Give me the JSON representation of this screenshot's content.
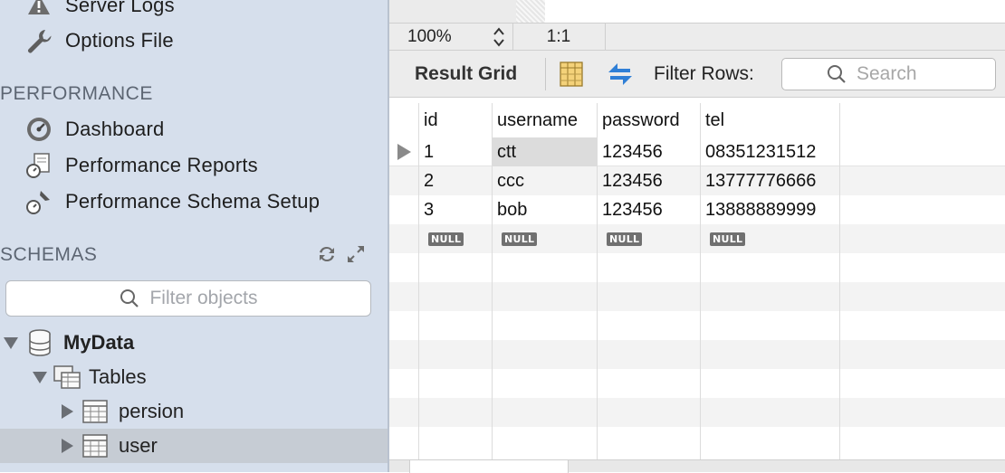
{
  "sidebar": {
    "top_items": [
      {
        "label": "Server Logs",
        "icon": "warning-icon"
      },
      {
        "label": "Options File",
        "icon": "wrench-icon"
      }
    ],
    "performance": {
      "header": "PERFORMANCE",
      "items": [
        {
          "label": "Dashboard",
          "icon": "dashboard-gauge-icon"
        },
        {
          "label": "Performance Reports",
          "icon": "performance-reports-icon"
        },
        {
          "label": "Performance Schema Setup",
          "icon": "schema-setup-icon"
        }
      ]
    },
    "schemas": {
      "header": "SCHEMAS",
      "filter_placeholder": "Filter objects",
      "tree": {
        "schema": "MyData",
        "tables_label": "Tables",
        "tables": [
          "persion",
          "user"
        ]
      }
    }
  },
  "main": {
    "zoom": "100%",
    "ratio": "1:1",
    "toolbar": {
      "result_grid_label": "Result Grid",
      "filter_rows_label": "Filter Rows:",
      "search_placeholder": "Search"
    },
    "grid": {
      "columns": [
        "id",
        "username",
        "password",
        "tel"
      ],
      "rows": [
        [
          "1",
          "ctt",
          "123456",
          "08351231512"
        ],
        [
          "2",
          "ccc",
          "123456",
          "13777776666"
        ],
        [
          "3",
          "bob",
          "123456",
          "13888889999"
        ]
      ],
      "null_label": "NULL"
    }
  },
  "colors": {
    "sidebar_bg": "#d6dfec",
    "selected_row": "#c6ccd4",
    "accent_blue": "#2f7fd6"
  }
}
